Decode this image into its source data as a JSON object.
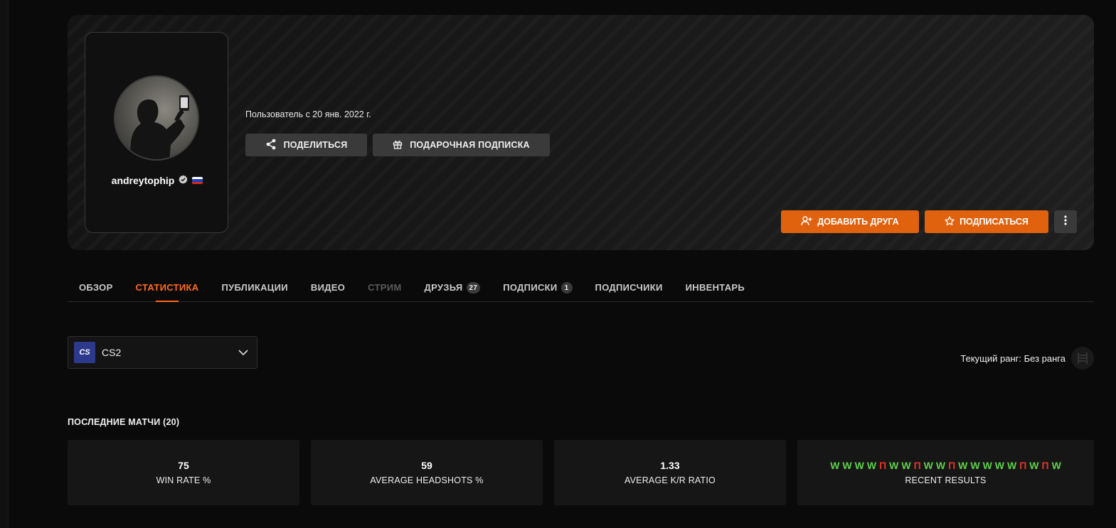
{
  "profile": {
    "username": "andreytophip",
    "member_since": "Пользователь с 20 янв. 2022 г.",
    "verified_icon": "verified-badge-icon",
    "flag_colors": [
      "#ffffff",
      "#1c3fbd",
      "#d52b1e"
    ]
  },
  "actions": {
    "share_label": "ПОДЕЛИТЬСЯ",
    "gift_label": "ПОДАРОЧНАЯ ПОДПИСКА",
    "add_friend_label": "ДОБАВИТЬ ДРУГА",
    "subscribe_label": "ПОДПИСАТЬСЯ"
  },
  "tabs": [
    {
      "label": "ОБЗОР",
      "state": "normal"
    },
    {
      "label": "СТАТИСТИКА",
      "state": "active"
    },
    {
      "label": "ПУБЛИКАЦИИ",
      "state": "normal"
    },
    {
      "label": "ВИДЕО",
      "state": "normal"
    },
    {
      "label": "СТРИМ",
      "state": "disabled"
    },
    {
      "label": "ДРУЗЬЯ",
      "state": "normal",
      "count": "27"
    },
    {
      "label": "ПОДПИСКИ",
      "state": "normal",
      "count": "1"
    },
    {
      "label": "ПОДПИСЧИКИ",
      "state": "normal"
    },
    {
      "label": "ИНВЕНТАРЬ",
      "state": "normal"
    }
  ],
  "game_select": {
    "logo_text": "CS",
    "value": "CS2"
  },
  "rank": {
    "label": "Текущий ранг: Без ранга"
  },
  "recent_matches": {
    "title": "ПОСЛЕДНИЕ МАТЧИ (20)",
    "stats": [
      {
        "value": "75",
        "label": "WIN RATE %"
      },
      {
        "value": "59",
        "label": "AVERAGE HEADSHOTS %"
      },
      {
        "value": "1.33",
        "label": "AVERAGE K/R RATIO"
      }
    ],
    "results": [
      "W",
      "W",
      "W",
      "W",
      "П",
      "W",
      "W",
      "П",
      "W",
      "W",
      "П",
      "W",
      "W",
      "W",
      "W",
      "W",
      "П",
      "W",
      "П",
      "W"
    ],
    "results_label": "RECENT RESULTS"
  },
  "colors": {
    "accent": "#e0620f",
    "win": "#5fd04a",
    "loss": "#e6342a"
  }
}
